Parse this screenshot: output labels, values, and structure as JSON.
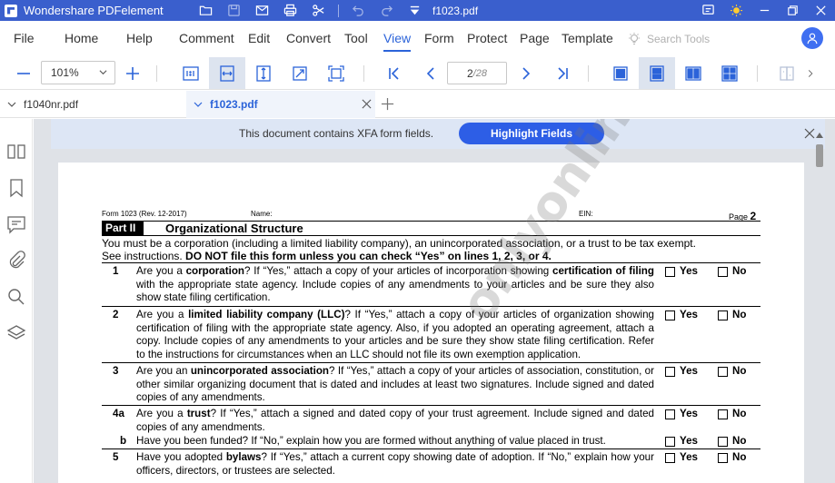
{
  "app": {
    "title": "Wondershare PDFelement",
    "file_name": "f1023.pdf"
  },
  "menu": {
    "items": [
      "File",
      "Home",
      "Help",
      "Comment",
      "Edit",
      "Convert",
      "Tool",
      "View",
      "Form",
      "Protect",
      "Page",
      "Template"
    ],
    "active": "View",
    "search_placeholder": "Search Tools"
  },
  "toolbar": {
    "zoom": "101%",
    "current_page": "2",
    "total_pages": "/28"
  },
  "tabs": [
    {
      "label": "f1040nr.pdf",
      "active": false
    },
    {
      "label": "f1023.pdf",
      "active": true
    }
  ],
  "notice": {
    "text": "This document contains XFA form fields.",
    "button": "Highlight Fields"
  },
  "document": {
    "form_no": "Form 1023 (Rev. 12-2017)",
    "name_label": "Name:",
    "ein_label": "EIN:",
    "page_label": "Page",
    "page_number": "2",
    "part_label": "Part II",
    "part_title": "Organizational Structure",
    "intro_line1": "You must be a corporation (including a limited liability company), an unincorporated association, or a trust to be tax exempt.",
    "intro_line2_a": "See instructions. ",
    "intro_line2_b": "DO NOT file this form unless you can check “Yes” on lines 1, 2, 3, or 4.",
    "yes_label": "Yes",
    "no_label": "No",
    "questions": [
      {
        "num": "1",
        "html": "Are you a <b>corporation</b>? If “Yes,” attach a copy of your articles of incorporation showing <b>certification of filing</b> with the appropriate state agency. Include copies of any amendments to your articles and be sure they also show state filing certification."
      },
      {
        "num": "2",
        "html": "Are you a <b>limited liability company (LLC)</b>? If “Yes,” attach a copy of your articles of organization showing certification of filing with the appropriate state agency. Also, if you adopted an operating agreement, attach a copy. Include copies of any amendments to your articles and be sure they show state filing certification. Refer to the instructions for circumstances when an LLC should not file its own exemption application."
      },
      {
        "num": "3",
        "html": "Are you an <b>unincorporated association</b>? If “Yes,” attach a copy of your articles of association, constitution, or other similar organizing document that is dated and includes at least two signatures. Include signed and dated copies of any amendments."
      },
      {
        "num": "4a",
        "html": "Are you a <b>trust</b>? If “Yes,” attach a signed and dated copy of your trust agreement. Include signed and dated copies of any amendments."
      },
      {
        "num": "b",
        "html": "Have you been funded? If “No,” explain how you are formed without anything of value placed in trust."
      },
      {
        "num": "5",
        "html": "Have you adopted <b>bylaws</b>? If “Yes,” attach a current copy showing date of adoption. If “No,” explain how your officers, directors, or trustees are selected."
      }
    ],
    "watermark": "onlyonlinetax.gov."
  }
}
